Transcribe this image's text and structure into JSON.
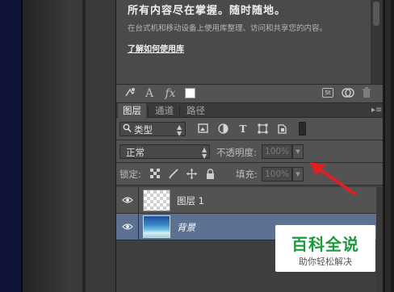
{
  "library": {
    "headline": "所有内容尽在掌握。随时随地。",
    "description": "在台式机和移动设备上使用库整理、访问和共享您的内容。",
    "link": "了解如何使用库"
  },
  "library_toolbar": {
    "items": [
      "add-graphic-icon",
      "character-style-icon",
      "layer-style-icon",
      "color-swatch-icon",
      "stock-icon",
      "cloud-sync-icon",
      "trash-icon"
    ],
    "text_icon": "A",
    "fx_icon": "fx",
    "stock_label": "St"
  },
  "tabs": [
    "图层",
    "通道",
    "路径"
  ],
  "active_tab": "图层",
  "filter": {
    "kind_label": "类型",
    "icons": [
      "pixel-filter-icon",
      "adjustment-filter-icon",
      "type-filter-icon",
      "shape-filter-icon",
      "smart-object-filter-icon"
    ]
  },
  "blend": {
    "mode": "正常",
    "opacity_label": "不透明度:",
    "opacity_value": "100%"
  },
  "lock": {
    "label": "锁定:",
    "icons": [
      "lock-transparent-icon",
      "lock-image-icon",
      "lock-position-icon",
      "lock-all-icon"
    ],
    "fill_label": "填充:",
    "fill_value": "100%"
  },
  "layers": [
    {
      "name": "图层 1",
      "visible": true,
      "selected": false,
      "thumbnail": "transparent"
    },
    {
      "name": "背景",
      "visible": true,
      "selected": true,
      "thumbnail": "sky-sea-image"
    }
  ],
  "annotation": {
    "arrow_color": "#e02020"
  },
  "watermark": {
    "title": "百科全说",
    "subtitle": "助你轻松解决",
    "color": "#1a9b3a"
  },
  "colors": {
    "panel_bg": "#535353",
    "selected_layer": "#5d7291"
  }
}
